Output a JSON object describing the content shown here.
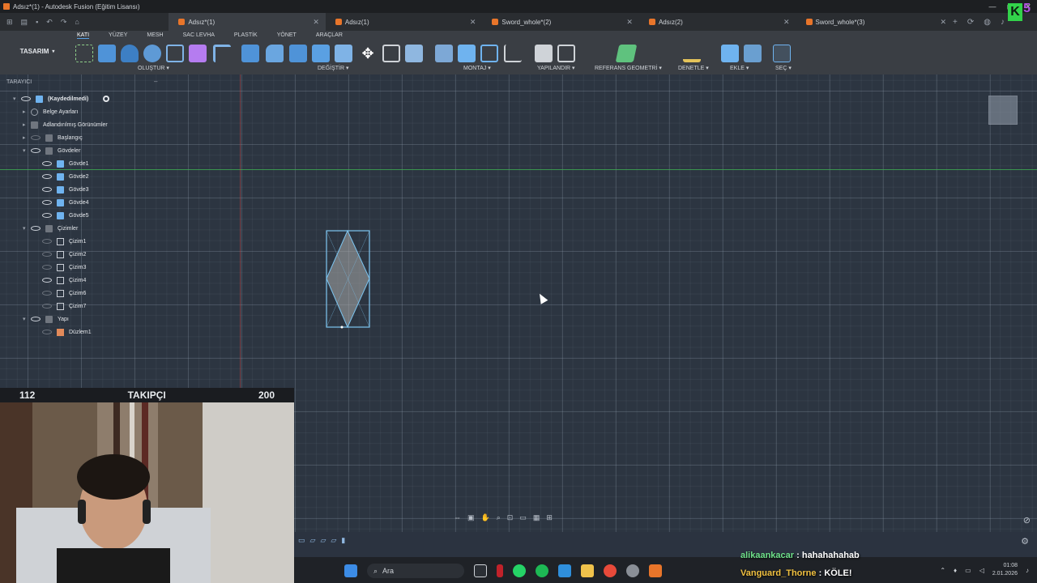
{
  "window": {
    "title": "Adsız*(1) - Autodesk Fusion (Eğitim Lisansı)"
  },
  "tabs": [
    {
      "label": "Adsız*(1)",
      "active": true
    },
    {
      "label": "Adsız(1)",
      "active": false
    },
    {
      "label": "Sword_whole*(2)",
      "active": false
    },
    {
      "label": "Adsız(2)",
      "active": false
    },
    {
      "label": "Sword_whole*(3)",
      "active": false
    }
  ],
  "toolbar": {
    "workspace": "TASARIM",
    "subtabs": [
      "KATI",
      "YÜZEY",
      "MESH",
      "SAC LEVHA",
      "PLASTİK",
      "YÖNET",
      "ARAÇLAR"
    ],
    "groups": [
      "OLUŞTUR",
      "DEĞİŞTİR",
      "MONTAJ",
      "YAPILANDIR",
      "REFERANS GEOMETRİ",
      "DENETLE",
      "EKLE",
      "SEÇ"
    ]
  },
  "browser": {
    "title": "TARAYICI",
    "root": "(Kaydedilmedi)",
    "items": [
      {
        "label": "Belge Ayarları"
      },
      {
        "label": "Adlandırılmış Görünümler"
      },
      {
        "label": "Başlangıç"
      },
      {
        "label": "Gövdeler"
      },
      {
        "label": "Gövde1"
      },
      {
        "label": "Gövde2"
      },
      {
        "label": "Gövde3"
      },
      {
        "label": "Gövde4"
      },
      {
        "label": "Gövde5"
      },
      {
        "label": "Çizimler"
      },
      {
        "label": "Çizim1"
      },
      {
        "label": "Çizim2"
      },
      {
        "label": "Çizim3"
      },
      {
        "label": "Çizim4"
      },
      {
        "label": "Çizim6"
      },
      {
        "label": "Çizim7"
      },
      {
        "label": "Yapı"
      },
      {
        "label": "Düzlem1"
      }
    ]
  },
  "followers": {
    "current": "112",
    "label": "TAKIPÇI",
    "goal": "200"
  },
  "taskbar": {
    "search": "Ara",
    "time": "01:08",
    "date": "2.01.2026"
  },
  "chat": [
    {
      "user": "alikaankacar",
      "sep": " : ",
      "message": "hahahahahab",
      "color": "#6fe08a"
    },
    {
      "user": "Vanguard_Thorne",
      "sep": " : ",
      "message": "KÖLE!",
      "color": "#f0c040"
    }
  ],
  "corner_badge": {
    "letter": "K",
    "number": "5"
  }
}
